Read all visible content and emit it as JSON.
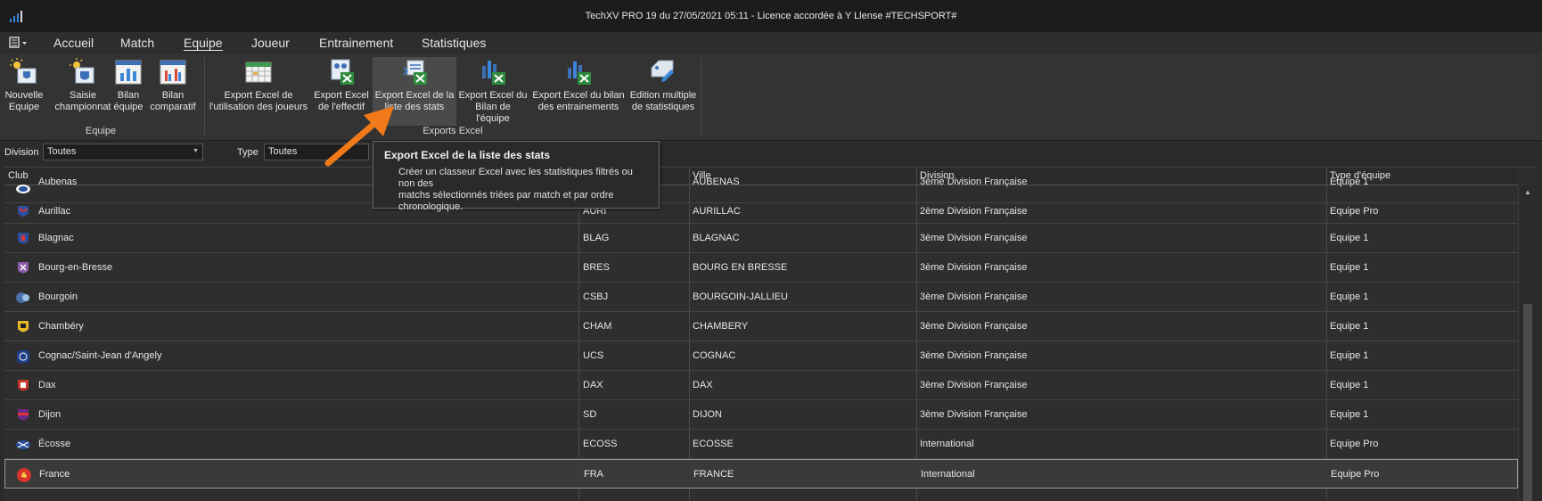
{
  "window": {
    "title": "TechXV PRO 19 du 27/05/2021 05:11  - Licence accordée à Y Llense #TECHSPORT#"
  },
  "menu": {
    "items": [
      {
        "label": "Accueil"
      },
      {
        "label": "Match"
      },
      {
        "label": "Equipe",
        "active": true
      },
      {
        "label": "Joueur"
      },
      {
        "label": "Entrainement"
      },
      {
        "label": "Statistiques"
      }
    ]
  },
  "ribbon": {
    "equipe": {
      "label": "Equipe",
      "buttons": [
        {
          "line1": "Nouvelle",
          "line2": "Equipe"
        },
        {
          "line1": "Saisie",
          "line2": "championnat"
        },
        {
          "line1": "Bilan",
          "line2": "équipe"
        },
        {
          "line1": "Bilan",
          "line2": "comparatif"
        }
      ]
    },
    "exports": {
      "label": "Exports Excel",
      "buttons": [
        {
          "line1": "Export Excel de",
          "line2": "l'utilisation des joueurs"
        },
        {
          "line1": "Export Excel",
          "line2": "de l'effectif"
        },
        {
          "line1": "Export Excel de la",
          "line2": "liste des stats"
        },
        {
          "line1": "Export Excel du",
          "line2": "Bilan de l'équipe"
        },
        {
          "line1": "Export Excel du bilan",
          "line2": "des entrainements"
        },
        {
          "line1": "Edition multiple",
          "line2": "de statistiques"
        }
      ]
    }
  },
  "filters": {
    "division": {
      "label": "Division",
      "value": "Toutes"
    },
    "type": {
      "label": "Type",
      "value": "Toutes"
    }
  },
  "tooltip": {
    "title": "Export Excel de la liste des stats",
    "line1": "Créer un classeur Excel avec les statistiques filtrés ou non des",
    "line2": "matchs  sélectionnés triées par match et par ordre",
    "line3": "chronologique."
  },
  "table": {
    "columns": {
      "club": "Club",
      "ville": "Ville",
      "division": "Division",
      "type": "Type d'équipe"
    },
    "rows": [
      {
        "club": "Aubenas",
        "code": "",
        "ville": "AUBENAS",
        "division": "3ème Division Française",
        "type": "Equipe 1"
      },
      {
        "club": "Aurillac",
        "code": "AURI",
        "ville": "AURILLAC",
        "division": "2ème Division Française",
        "type": "Equipe Pro"
      },
      {
        "club": "Blagnac",
        "code": "BLAG",
        "ville": "BLAGNAC",
        "division": "3ème Division Française",
        "type": "Equipe 1"
      },
      {
        "club": "Bourg-en-Bresse",
        "code": "BRES",
        "ville": "BOURG EN BRESSE",
        "division": "3ème Division Française",
        "type": "Equipe 1"
      },
      {
        "club": "Bourgoin",
        "code": "CSBJ",
        "ville": "BOURGOIN-JALLIEU",
        "division": "3ème Division Française",
        "type": "Equipe 1"
      },
      {
        "club": "Chambéry",
        "code": "CHAM",
        "ville": "CHAMBERY",
        "division": "3ème Division Française",
        "type": "Equipe 1"
      },
      {
        "club": "Cognac/Saint-Jean d'Angely",
        "code": "UCS",
        "ville": "COGNAC",
        "division": "3ème Division Française",
        "type": "Equipe 1"
      },
      {
        "club": "Dax",
        "code": "DAX",
        "ville": "DAX",
        "division": "3ème Division Française",
        "type": "Equipe 1"
      },
      {
        "club": "Dijon",
        "code": "SD",
        "ville": "DIJON",
        "division": "3ème Division Française",
        "type": "Equipe 1"
      },
      {
        "club": "Écosse",
        "code": "ECOSS",
        "ville": "ECOSSE",
        "division": "International",
        "type": "Equipe Pro"
      },
      {
        "club": "France",
        "code": "FRA",
        "ville": "FRANCE",
        "division": "International",
        "type": "Equipe Pro"
      }
    ]
  },
  "colors": {
    "accent": "#f07a1a",
    "background": "#2b2b2b",
    "titlebar": "#1c1c1c",
    "excel_green": "#2e8b3e"
  }
}
